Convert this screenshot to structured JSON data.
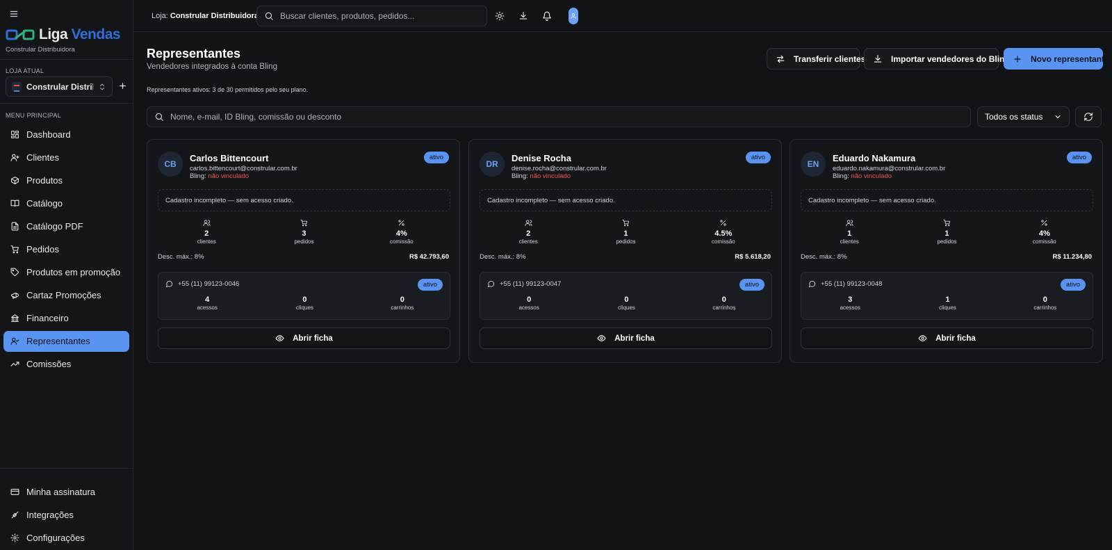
{
  "sidebar": {
    "logo": {
      "part1": "Liga",
      "part2": "Vendas",
      "subtitle": "Constrular Distribuidora"
    },
    "current_store_label": "LOJA ATUAL",
    "current_store_name": "Constrular Distrib...",
    "menu_label": "MENU PRINCIPAL",
    "items": [
      {
        "label": "Dashboard",
        "icon": "dashboard-icon"
      },
      {
        "label": "Clientes",
        "icon": "users-icon"
      },
      {
        "label": "Produtos",
        "icon": "box-icon"
      },
      {
        "label": "Catálogo",
        "icon": "book-icon"
      },
      {
        "label": "Catálogo PDF",
        "icon": "file-icon"
      },
      {
        "label": "Pedidos",
        "icon": "cart-icon"
      },
      {
        "label": "Produtos em promoção",
        "icon": "tag-icon"
      },
      {
        "label": "Cartaz Promoções",
        "icon": "megaphone-icon"
      },
      {
        "label": "Financeiro",
        "icon": "bank-icon"
      },
      {
        "label": "Representantes",
        "icon": "user-check-icon",
        "active": true
      },
      {
        "label": "Comissões",
        "icon": "trending-icon"
      }
    ],
    "bottom_items": [
      {
        "label": "Minha assinatura",
        "icon": "credit-card-icon"
      },
      {
        "label": "Integrações",
        "icon": "plug-icon"
      },
      {
        "label": "Configurações",
        "icon": "settings-icon"
      }
    ]
  },
  "topbar": {
    "store_prefix": "Loja:",
    "store_name": "Constrular Distribuidora",
    "search_placeholder": "Buscar clientes, produtos, pedidos..."
  },
  "page": {
    "title": "Representantes",
    "subtitle": "Vendedores integrados à conta Bling",
    "quota": "Representantes ativos: 3 de 30 permitidos pelo seu plano.",
    "buttons": {
      "transfer": "Transferir clientes",
      "import": "Importar vendedores do Bling",
      "new": "Novo representante"
    },
    "filter_placeholder": "Nome, e-mail, ID Bling, comissão ou desconto",
    "status_filter": "Todos os status"
  },
  "labels": {
    "bling_prefix": "Bling:",
    "bling_status": "não vinculado",
    "notice": "Cadastro incompleto — sem acesso criado.",
    "clients": "clientes",
    "orders": "pedidos",
    "commission": "comissão",
    "max_discount_prefix": "Desc. máx.:",
    "accesses": "acessos",
    "clicks": "cliques",
    "carts": "carrinhos",
    "open": "Abrir ficha"
  },
  "reps": [
    {
      "initials": "CB",
      "name": "Carlos Bittencourt",
      "email": "carlos.bittencourt@constrular.com.br",
      "status": "ativo",
      "clients": "2",
      "orders": "3",
      "commission": "4%",
      "max_discount": "8%",
      "amount": "R$ 42.793,60",
      "phone": "+55 (11) 99123-0046",
      "contact_status": "ativo",
      "accesses": "4",
      "clicks": "0",
      "carts": "0"
    },
    {
      "initials": "DR",
      "name": "Denise Rocha",
      "email": "denise.rocha@constrular.com.br",
      "status": "ativo",
      "clients": "2",
      "orders": "1",
      "commission": "4.5%",
      "max_discount": "8%",
      "amount": "R$ 5.618,20",
      "phone": "+55 (11) 99123-0047",
      "contact_status": "ativo",
      "accesses": "0",
      "clicks": "0",
      "carts": "0"
    },
    {
      "initials": "EN",
      "name": "Eduardo Nakamura",
      "email": "eduardo.nakamura@constrular.com.br",
      "status": "ativo",
      "clients": "1",
      "orders": "1",
      "commission": "4%",
      "max_discount": "8%",
      "amount": "R$ 11.234,80",
      "phone": "+55 (11) 99123-0048",
      "contact_status": "ativo",
      "accesses": "3",
      "clicks": "1",
      "carts": "0"
    }
  ]
}
